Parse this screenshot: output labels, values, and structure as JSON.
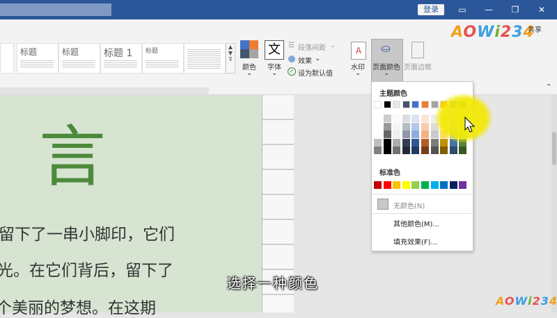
{
  "titlebar": {
    "login_label": "登录"
  },
  "logo_text": "AOWi234",
  "share_label": "共享",
  "ribbon": {
    "styles": [
      "标题",
      "标题",
      "标题 1",
      "标题"
    ],
    "color_btn": "颜色",
    "font_btn": "字体",
    "para_spacing": "段落间距",
    "effects": "效果",
    "set_default": "设为默认值",
    "watermark": "水印",
    "page_color": "页面颜色",
    "page_border": "页面边框",
    "font_glyph": "文"
  },
  "document": {
    "big_char": "言",
    "lines": [
      "留下了一串小脚印，它们",
      "光。在它们背后，留下了",
      "个美丽的梦想。在这期"
    ]
  },
  "dropdown": {
    "theme_colors_label": "主题颜色",
    "standard_colors_label": "标准色",
    "no_color": "无颜色(N)",
    "more_colors": "其他颜色(M)...",
    "fill_effects": "填充效果(F)...",
    "theme_top": [
      "#ffffff",
      "#000000",
      "#e7e6e6",
      "#44546a",
      "#4472c4",
      "#ed7d31",
      "#a5a5a5",
      "#ffc000",
      "#5b9bd5",
      "#70ad47"
    ],
    "standard": [
      "#c00000",
      "#ff0000",
      "#ffc000",
      "#ffff00",
      "#92d050",
      "#00b050",
      "#00b0f0",
      "#0070c0",
      "#002060",
      "#7030a0"
    ]
  },
  "subtitle": "选择一种颜色"
}
